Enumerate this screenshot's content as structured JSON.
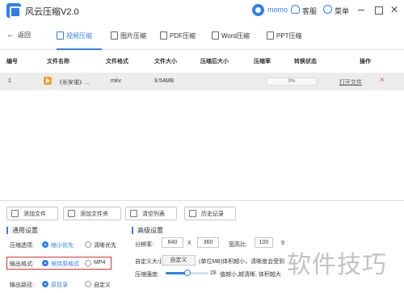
{
  "app": {
    "title": "风云压缩V2.0",
    "user": "momo",
    "service_label": "客服",
    "menu_label": "菜单",
    "accent": "#2d7ff0"
  },
  "nav": {
    "back_label": "返回",
    "tabs": [
      {
        "label": "视频压缩",
        "active": true
      },
      {
        "label": "图片压缩"
      },
      {
        "label": "PDF压缩"
      },
      {
        "label": "Word压缩"
      },
      {
        "label": "PPT压缩"
      }
    ]
  },
  "table": {
    "headers": [
      "编号",
      "文件名称",
      "文件格式",
      "文件大小",
      "压缩后大小",
      "压缩率",
      "转换状态",
      "操作"
    ],
    "rows": [
      {
        "index": "1",
        "name": "《长安诺》...",
        "format": "mkv",
        "size": "9.54MB",
        "compressed_size": "",
        "ratio": "",
        "progress_text": "0%",
        "progress": 0,
        "open_label": "打开文件",
        "delete_icon": "×"
      }
    ]
  },
  "actions": {
    "add_file": "添加文件",
    "add_folder": "添加文件夹",
    "clear_list": "清空列表",
    "history": "历史记录"
  },
  "general": {
    "title": "通用设置",
    "mode_label": "压缩选项:",
    "mode_options": [
      "缩小优先",
      "清晰优先"
    ],
    "output_format_label": "输出格式:",
    "output_format_options": [
      "保持原格式",
      "MP4"
    ],
    "output_path_label": "输出路径:",
    "output_path_options": [
      "原目录",
      "自定义"
    ]
  },
  "advanced": {
    "title": "高级设置",
    "resolution_label": "分辨率:",
    "width": "640",
    "times": "X",
    "height": "360",
    "aspect_label": "宽高比:",
    "aspect_value": "100",
    "aspect_cutoff": "9",
    "custom_size_label": "自定义大小:",
    "custom_button": "自定义",
    "custom_hint": "(单位MB)体积越小，清晰度会受到",
    "strength_label": "压缩强度:",
    "strength_value": "28",
    "strength_hint": "值越小,越清晰, 体积越大",
    "strength_fraction": 0.5
  },
  "watermark": "软件技巧"
}
